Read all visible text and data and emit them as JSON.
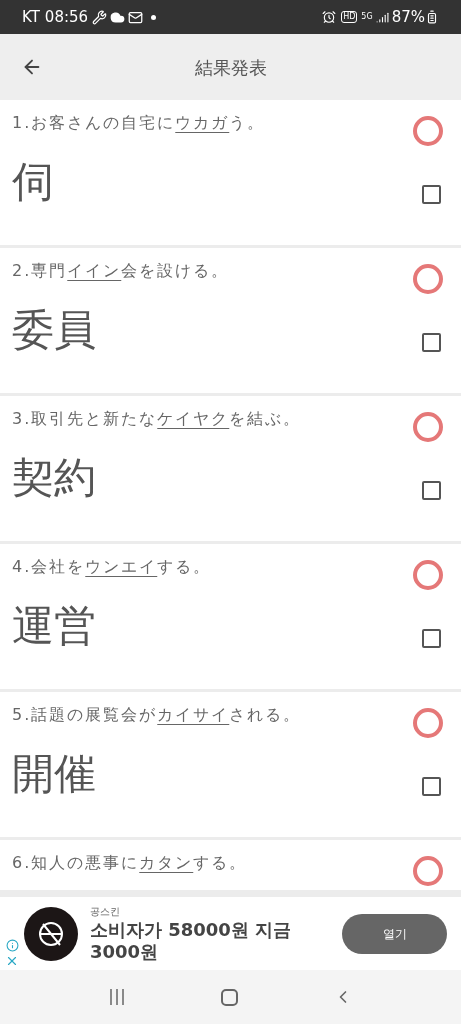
{
  "status_bar": {
    "carrier": "KT",
    "time": "08:56",
    "hd_badge": "HD",
    "network_badge": "5G",
    "battery": "87%"
  },
  "header": {
    "title": "結果発表"
  },
  "items": [
    {
      "number": "1.",
      "before": "お客さんの自宅に",
      "target": "ウカガ",
      "after": "う。",
      "answer": "伺",
      "correct": true,
      "checked": false
    },
    {
      "number": "2.",
      "before": "専門",
      "target": "イイン",
      "after": "会を設ける。",
      "answer": "委員",
      "correct": true,
      "checked": false
    },
    {
      "number": "3.",
      "before": "取引先と新たな",
      "target": "ケイヤク",
      "after": "を結ぶ。",
      "answer": "契約",
      "correct": true,
      "checked": false
    },
    {
      "number": "4.",
      "before": "会社を",
      "target": "ウンエイ",
      "after": "する。",
      "answer": "運営",
      "correct": true,
      "checked": false
    },
    {
      "number": "5.",
      "before": "話題の展覧会が",
      "target": "カイサイ",
      "after": "される。",
      "answer": "開催",
      "correct": true,
      "checked": false
    },
    {
      "number": "6.",
      "before": "知人の悪事に",
      "target": "カタン",
      "after": "する。",
      "correct": true
    }
  ],
  "ad": {
    "advertiser": "공스킨",
    "headline": "소비자가 58000원 지금 3000원",
    "button": "열기"
  }
}
